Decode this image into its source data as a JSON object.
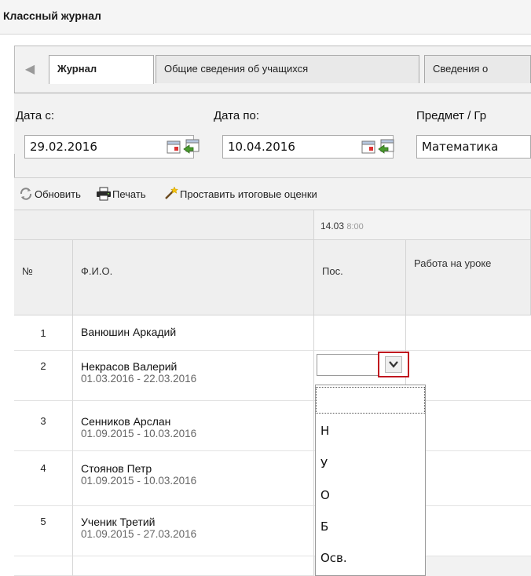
{
  "window": {
    "title": "Классный журнал"
  },
  "tabs": [
    {
      "label": "Журнал",
      "active": true
    },
    {
      "label": "Общие сведения об учащихся",
      "active": false
    },
    {
      "label": "Сведения о",
      "active": false
    }
  ],
  "filters": {
    "date_from_label": "Дата с:",
    "date_from_value": "29.02.2016",
    "date_to_label": "Дата по:",
    "date_to_value": "10.04.2016",
    "subject_label": "Предмет / Гр",
    "subject_value": "Математика"
  },
  "toolbar": {
    "refresh": "Обновить",
    "print": "Печать",
    "final_grades": "Проставить итоговые оценки"
  },
  "grid": {
    "lesson_header": "14.03",
    "lesson_time": "8:00",
    "col_num": "№",
    "col_fio": "Ф.И.О.",
    "col_attendance": "Пос.",
    "col_work": "Работа на уроке",
    "rows": [
      {
        "num": "1",
        "name": "Ванюшин Аркадий",
        "dates": ""
      },
      {
        "num": "2",
        "name": "Некрасов Валерий",
        "dates": "01.03.2016 - 22.03.2016"
      },
      {
        "num": "3",
        "name": "Сенников Арслан",
        "dates": "01.09.2015 - 10.03.2016"
      },
      {
        "num": "4",
        "name": "Стоянов Петр",
        "dates": "01.09.2015 - 10.03.2016"
      },
      {
        "num": "5",
        "name": "Ученик Третий",
        "dates": "01.09.2015 - 27.03.2016"
      }
    ]
  },
  "attendance_dropdown": {
    "value": "",
    "options": [
      "",
      "Н",
      "У",
      "О",
      "Б",
      "Осв."
    ]
  },
  "colors": {
    "highlight": "#c0101e",
    "panel": "#f2f2f2"
  }
}
